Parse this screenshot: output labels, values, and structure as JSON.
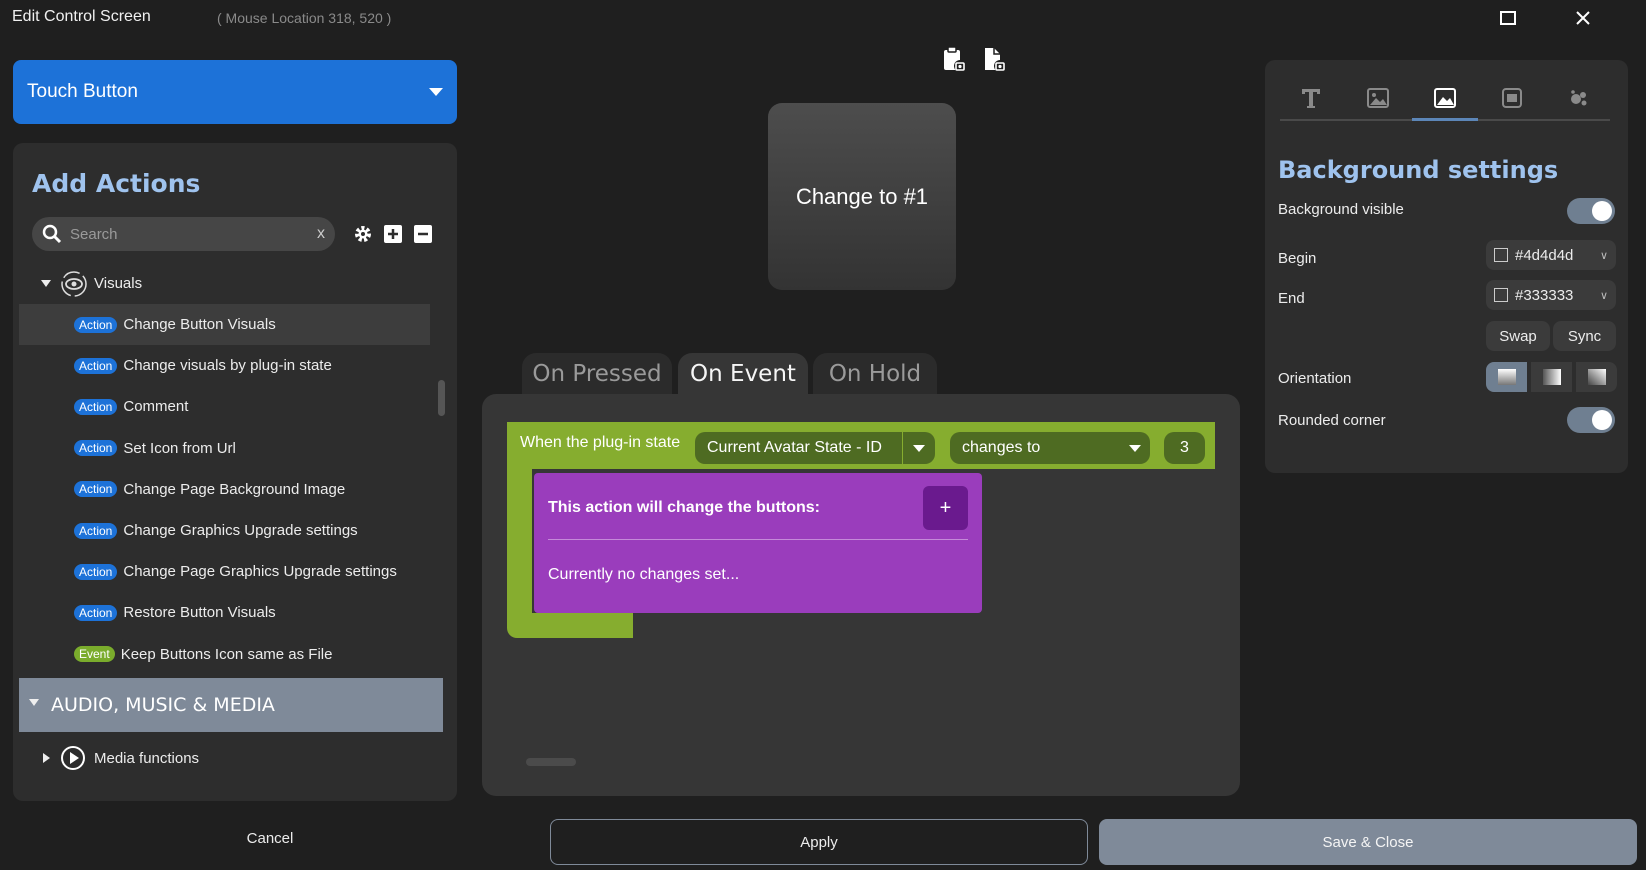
{
  "window": {
    "title": "Edit Control Screen",
    "mouse_location": "( Mouse Location 318, 520 )",
    "maximize_glyph": "☐",
    "close_glyph": "✕"
  },
  "left": {
    "type_select": "Touch Button",
    "panel_title": "Add Actions",
    "search_placeholder": "Search",
    "search_clear": "x",
    "tree": {
      "group_label": "Visuals",
      "items": [
        {
          "badge": "Action",
          "label": "Change Button Visuals"
        },
        {
          "badge": "Action",
          "label": "Change visuals by plug-in state"
        },
        {
          "badge": "Action",
          "label": "Comment"
        },
        {
          "badge": "Action",
          "label": "Set Icon from Url"
        },
        {
          "badge": "Action",
          "label": "Change Page Background Image"
        },
        {
          "badge": "Action",
          "label": "Change Graphics Upgrade settings"
        },
        {
          "badge": "Action",
          "label": "Change Page Graphics Upgrade settings"
        },
        {
          "badge": "Action",
          "label": "Restore Button Visuals"
        },
        {
          "badge": "Event",
          "label": "Keep Buttons Icon same as File"
        }
      ],
      "category": "AUDIO, MUSIC & MEDIA",
      "sub_group": "Media functions"
    }
  },
  "center": {
    "preview_text": "Change to #1",
    "tabs": [
      {
        "label": "On Pressed",
        "active": false
      },
      {
        "label": "On Event",
        "active": true
      },
      {
        "label": "On Hold",
        "active": false
      }
    ],
    "event_block": {
      "label": "When the plug-in state",
      "state_select": "Current Avatar State - ID",
      "condition_select": "changes to",
      "value": "3"
    },
    "action_block": {
      "title": "This action will change the buttons:",
      "add_label": "+",
      "note": "Currently no changes set..."
    }
  },
  "right": {
    "tab_icons": [
      "text-icon",
      "image-icon",
      "background-icon",
      "overlay-icon",
      "effects-icon"
    ],
    "active_tab": 2,
    "section_title": "Background settings",
    "background_visible_label": "Background visible",
    "background_visible": true,
    "begin_label": "Begin",
    "begin_color": "#4d4d4d",
    "end_label": "End",
    "end_color": "#333333",
    "swap_label": "Swap",
    "sync_label": "Sync",
    "orientation_label": "Orientation",
    "orientation_selected": 0,
    "rounded_corner_label": "Rounded corner",
    "rounded_corner": true
  },
  "bottom": {
    "cancel": "Cancel",
    "apply": "Apply",
    "save_close": "Save & Close"
  },
  "colors": {
    "accent_blue": "#1d72d8",
    "event_green": "#86ad2f",
    "action_purple": "#9a3dbc",
    "title_blue": "#9fc3ee",
    "slate": "#7f8a99"
  }
}
